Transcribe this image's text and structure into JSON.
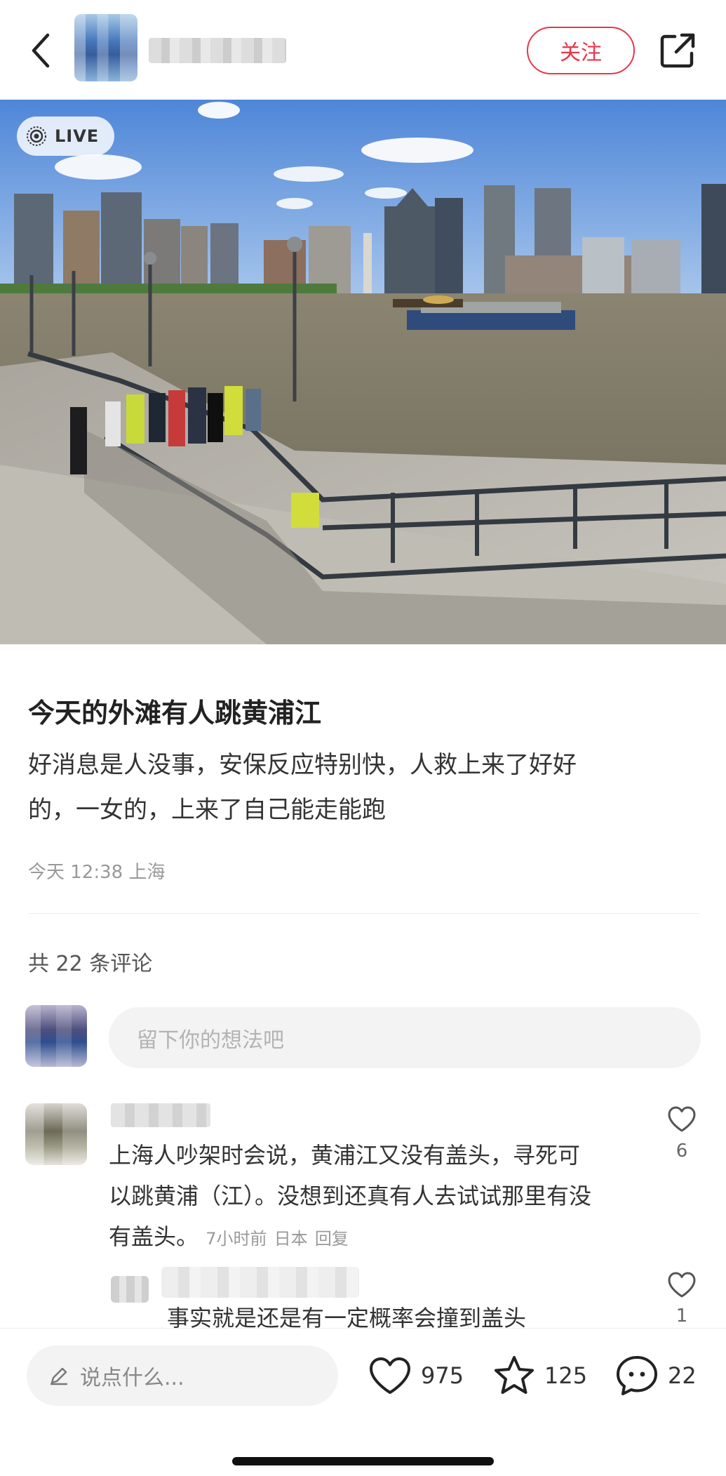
{
  "header": {
    "back_icon": "chevron-left-icon",
    "follow_label": "关注",
    "share_icon": "share-icon",
    "accent_color": "#e8364b"
  },
  "photo": {
    "live_label": "LIVE"
  },
  "post": {
    "title": "今天的外滩有人跳黄浦江",
    "body_line1": "好消息是人没事，安保反应特别快，人救上来了好好",
    "body_line2": "的，一女的，上来了自己能走能跑",
    "meta": "今天 12:38 上海"
  },
  "comments": {
    "count_label": "共 22 条评论",
    "input_placeholder": "留下你的想法吧",
    "items": [
      {
        "line1": "上海人吵架时会说，黄浦江又没有盖头，寻死可",
        "line2": "以跳黄浦（江）。没想到还真有人去试试那里有没",
        "line3": "有盖头。",
        "time": "7小时前",
        "location": "日本",
        "reply_label": "回复",
        "likes": "6"
      },
      {
        "text": "事实就是还是有一定概率会撞到盖头",
        "likes": "1"
      }
    ]
  },
  "bottom_bar": {
    "say_placeholder": "说点什么...",
    "likes": "975",
    "favorites": "125",
    "comments": "22"
  }
}
